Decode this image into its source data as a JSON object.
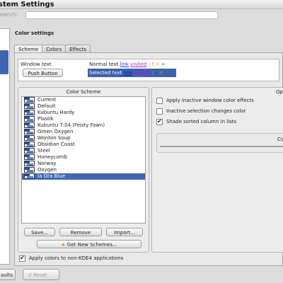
{
  "window": {
    "title": "stem Settings"
  },
  "search": {
    "label": "earch:",
    "placeholder": ""
  },
  "section": {
    "title": "Color settings"
  },
  "tabs": [
    "Scheme",
    "Colors",
    "Effects"
  ],
  "preview": {
    "window_text_label": "Window text",
    "push_button_label": "Push Button",
    "normal_text": "Normal text",
    "selected_text": "Selected text",
    "link": "link",
    "visited": "visited",
    "neutral_sym": "¡",
    "negative_sym": "!",
    "active_sym": "=",
    "positive_sym": "+"
  },
  "color_scheme": {
    "title": "Color Scheme",
    "items": [
      "Current",
      "Default",
      "Kubuntu Hardy",
      "Plastik",
      "Kubuntu 7.04 (Feisty Fawn)",
      "Green Oxygen",
      "Wonton Soup",
      "Obsidian Coast",
      "Steel",
      "Honeycomb",
      "Norway",
      "Oxygen",
      "Ia Ora Blue"
    ],
    "selected_index": 12,
    "save_label": "Save...",
    "remove_label": "Remove",
    "import_label": "Import...",
    "get_new_label": "Get New Schemes..."
  },
  "options": {
    "title": "Opti",
    "apply_inactive_label": "Apply inactive window color effects",
    "apply_inactive_checked": false,
    "inactive_selection_label": "Inactive selection changes color",
    "inactive_selection_checked": false,
    "shade_sorted_label": "Shade sorted column in lists",
    "shade_sorted_checked": true,
    "contrast_label": "Cont"
  },
  "apply_nonkde": {
    "label": "Apply colors to non-KDE4 applications",
    "checked": true
  },
  "footer": {
    "defaults_label": "aults",
    "reset_label": "Reset"
  },
  "colors": {
    "selection": "#3f67b2",
    "link": "#1b3ec8",
    "visited": "#a42fd0"
  }
}
